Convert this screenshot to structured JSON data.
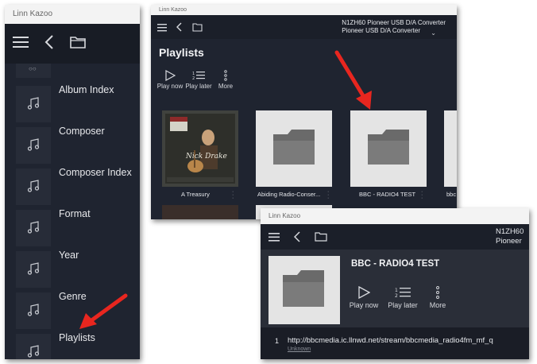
{
  "accent_arrow": "#e8261f",
  "window_main": {
    "title": "Linn Kazoo",
    "menu_items": [
      {
        "label": "Album Index",
        "icon": "music-note-icon"
      },
      {
        "label": "Composer",
        "icon": "music-note-icon"
      },
      {
        "label": "Composer Index",
        "icon": "music-note-icon"
      },
      {
        "label": "Format",
        "icon": "music-note-icon"
      },
      {
        "label": "Year",
        "icon": "music-note-icon"
      },
      {
        "label": "Genre",
        "icon": "music-note-icon"
      },
      {
        "label": "Playlists",
        "icon": "music-note-icon"
      }
    ]
  },
  "window_playlists": {
    "title": "Linn Kazoo",
    "device_line1": "N1ZH60 Pioneer USB D/A Converter",
    "device_line2": "Pioneer USB D/A Converter",
    "heading": "Playlists",
    "actions": {
      "play_now": "Play now",
      "play_later": "Play later",
      "more": "More"
    },
    "cards": [
      {
        "label": "A Treasury"
      },
      {
        "label": "Abiding Radio-Conser..."
      },
      {
        "label": "BBC - RADIO4 TEST"
      },
      {
        "label": "bbc"
      }
    ]
  },
  "window_detail": {
    "title": "Linn Kazoo",
    "device_line1": "N1ZH60",
    "device_line2": "Pioneer",
    "playlist_title": "BBC - RADIO4 TEST",
    "actions": {
      "play_now": "Play now",
      "play_later": "Play later",
      "more": "More"
    },
    "track": {
      "number": "1",
      "url": "http://bbcmedia.ic.llnwd.net/stream/bbcmedia_radio4fm_mf_q",
      "artist": "Unknown"
    }
  }
}
